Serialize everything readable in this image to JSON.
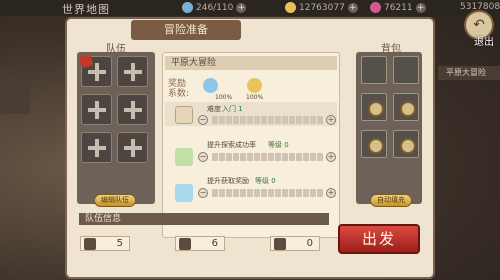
{
  "top": {
    "map_title": "世界地图",
    "stamina": "246/110",
    "gold": "12763077",
    "gems": "76211",
    "extra": "5317808"
  },
  "exit_label": "退出",
  "panel": {
    "header": "冒险准备",
    "team_title": "队伍",
    "bag_title": "背包",
    "team_btn": "编辑队伍",
    "bag_btn": "自动填充"
  },
  "adventure": {
    "title": "平原大冒险",
    "reward_label": "奖励",
    "reward_label2": "系数:",
    "reward_pct_1": "100%",
    "reward_pct_2": "100%",
    "rows": [
      {
        "title": "难度",
        "sub": "入门 1"
      },
      {
        "title": "提升探索成功率",
        "sub": "等级 0"
      },
      {
        "title": "提升获取奖励",
        "sub": "等级 0"
      }
    ]
  },
  "team_info": {
    "label": "队伍信息",
    "stat1": "5",
    "stat2": "6",
    "stat3": "0"
  },
  "go_button": "出发",
  "side_right_label": "平原大冒险",
  "colors": {
    "panel_bg": "#efe4cf",
    "header_brown": "#7a5c45",
    "go_red": "#c23a30"
  }
}
